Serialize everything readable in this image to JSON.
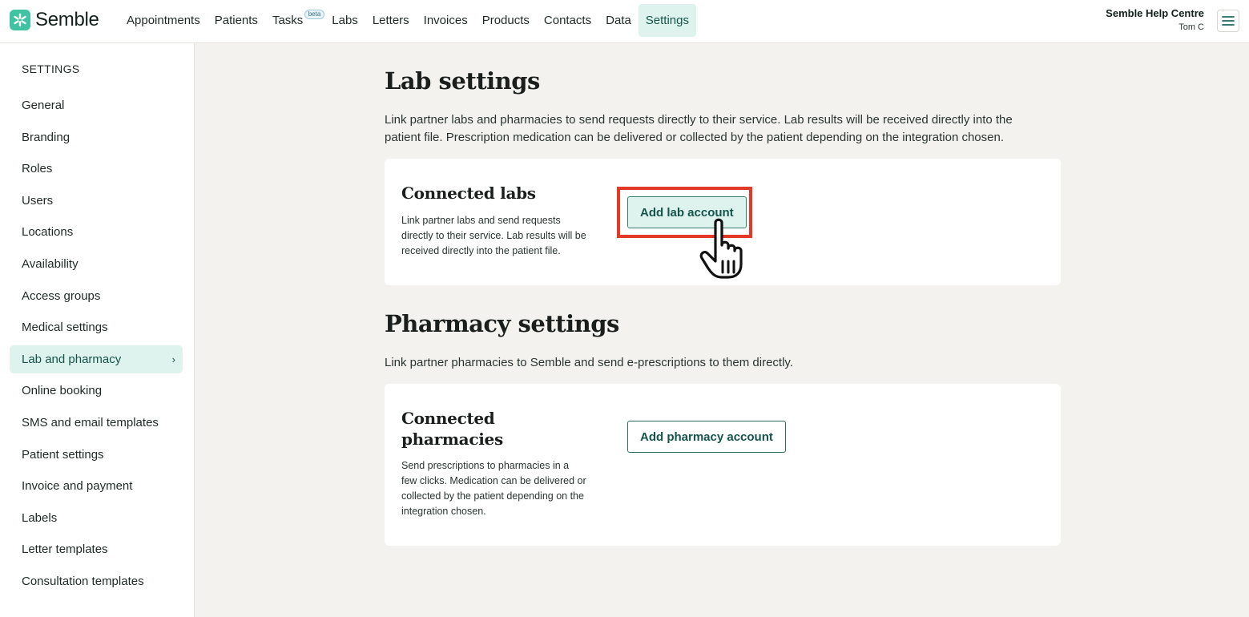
{
  "brand": {
    "name": "Semble",
    "accent": "#3fc3a3"
  },
  "nav": {
    "items": [
      {
        "label": "Appointments"
      },
      {
        "label": "Patients"
      },
      {
        "label": "Tasks",
        "badge": "beta"
      },
      {
        "label": "Labs"
      },
      {
        "label": "Letters"
      },
      {
        "label": "Invoices"
      },
      {
        "label": "Products"
      },
      {
        "label": "Contacts"
      },
      {
        "label": "Data"
      },
      {
        "label": "Settings",
        "active": true
      }
    ]
  },
  "header": {
    "help_title": "Semble Help Centre",
    "user_name": "Tom C",
    "menu_icon": "hamburger-icon"
  },
  "sidebar": {
    "heading": "SETTINGS",
    "items": [
      {
        "label": "General"
      },
      {
        "label": "Branding"
      },
      {
        "label": "Roles"
      },
      {
        "label": "Users"
      },
      {
        "label": "Locations"
      },
      {
        "label": "Availability"
      },
      {
        "label": "Access groups"
      },
      {
        "label": "Medical settings"
      },
      {
        "label": "Lab and pharmacy",
        "active": true
      },
      {
        "label": "Online booking"
      },
      {
        "label": "SMS and email templates"
      },
      {
        "label": "Patient settings"
      },
      {
        "label": "Invoice and payment"
      },
      {
        "label": "Labels"
      },
      {
        "label": "Letter templates"
      },
      {
        "label": "Consultation templates"
      }
    ]
  },
  "lab": {
    "title": "Lab settings",
    "description": "Link partner labs and pharmacies to send requests directly to their service. Lab results will be received directly into the patient file. Prescription medication can be delivered or collected by the patient depending on the integration chosen.",
    "card_title": "Connected labs",
    "card_description": "Link partner labs and send requests directly to their service. Lab results will be received directly into the patient file.",
    "button_label": "Add lab account"
  },
  "pharmacy": {
    "title": "Pharmacy settings",
    "description": "Link partner pharmacies to Semble and send e-prescriptions to them directly.",
    "card_title": "Connected pharmacies",
    "card_description": "Send prescriptions to pharmacies in a few clicks. Medication can be delivered or collected by the patient depending on the integration chosen.",
    "button_label": "Add pharmacy account"
  },
  "annotation": {
    "highlight_color": "#e23a26",
    "cursor_icon": "pointer-hand-icon"
  }
}
